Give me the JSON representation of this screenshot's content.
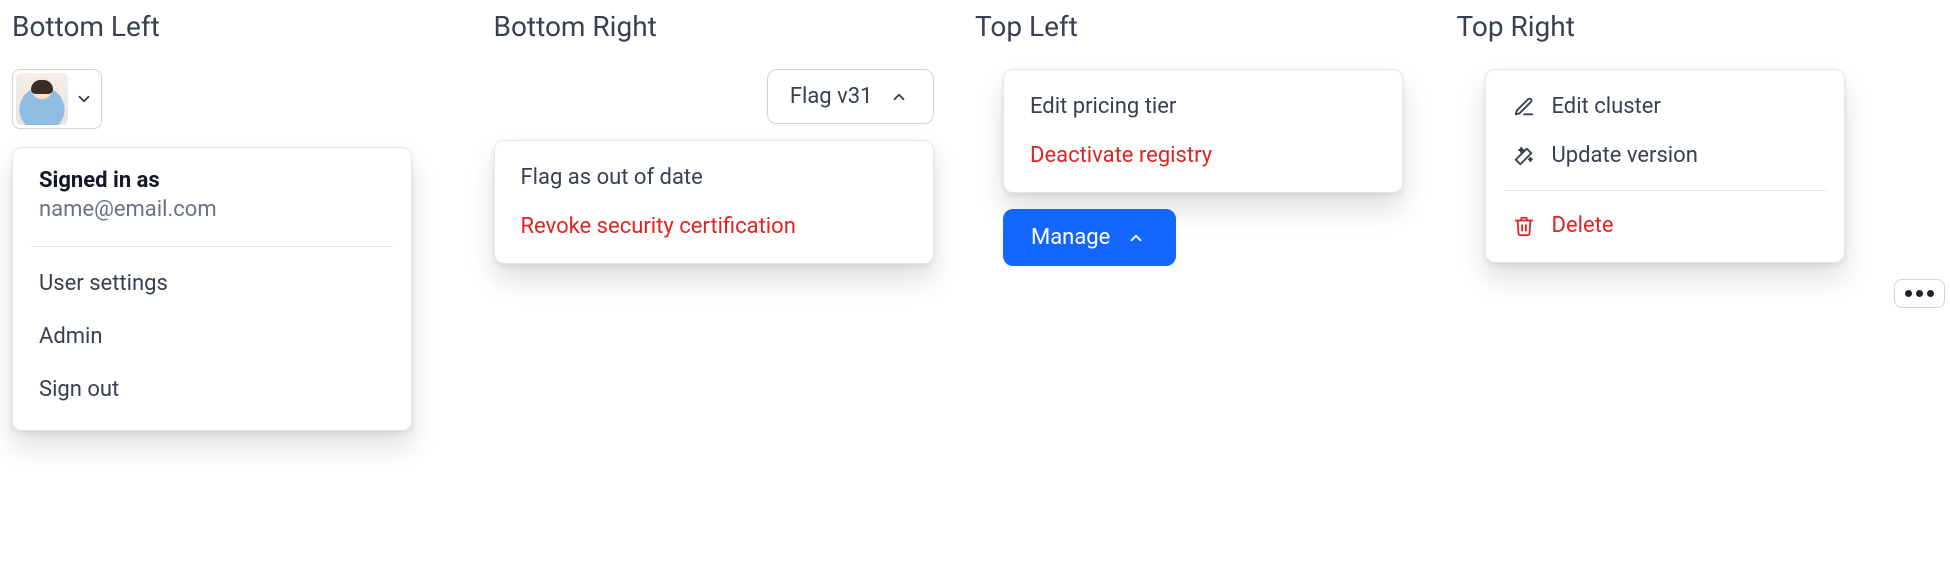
{
  "columns": {
    "bottom_left": {
      "title": "Bottom Left",
      "user": {
        "signed_in_as_label": "Signed in as",
        "email": "name@email.com",
        "items": {
          "user_settings": "User settings",
          "admin": "Admin",
          "sign_out": "Sign out"
        }
      }
    },
    "bottom_right": {
      "title": "Bottom Right",
      "trigger_label": "Flag v31",
      "items": {
        "flag_ood": "Flag as out of date",
        "revoke": "Revoke security certification"
      }
    },
    "top_left": {
      "title": "Top Left",
      "items": {
        "edit_pricing": "Edit pricing tier",
        "deactivate": "Deactivate registry"
      },
      "trigger_label": "Manage"
    },
    "top_right": {
      "title": "Top Right",
      "items": {
        "edit_cluster": "Edit cluster",
        "update_version": "Update version",
        "delete": "Delete"
      }
    }
  },
  "colors": {
    "primary": "#1366ff",
    "danger": "#e02424",
    "border": "#e5e7eb",
    "text": "#374151",
    "muted": "#6b7280"
  },
  "icons": {
    "chevron_down": "chevron-down-icon",
    "chevron_up": "chevron-up-icon",
    "edit": "pencil-square-icon",
    "magic": "magic-wand-icon",
    "trash": "trash-icon",
    "kebab": "more-horizontal-icon"
  }
}
